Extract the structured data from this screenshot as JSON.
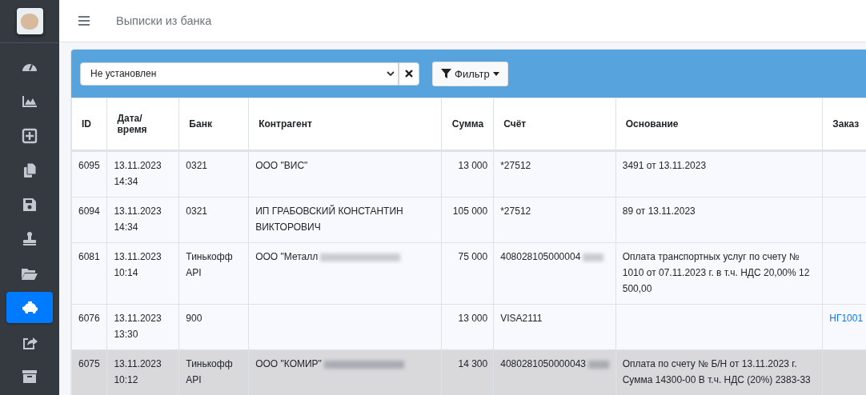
{
  "header": {
    "title": "Выписки из банка"
  },
  "sidebar": {
    "items": [
      {
        "selected": false
      },
      {
        "selected": false
      },
      {
        "selected": false
      },
      {
        "selected": false
      },
      {
        "selected": false
      },
      {
        "selected": false
      },
      {
        "selected": false
      },
      {
        "selected": true
      },
      {
        "selected": false
      },
      {
        "selected": false
      }
    ]
  },
  "filter": {
    "select_value": "Не установлен",
    "filter_button": "Фильтр"
  },
  "table": {
    "columns": [
      "ID",
      "Дата/ время",
      "Банк",
      "Контрагент",
      "Сумма",
      "Счёт",
      "Основание",
      "Заказ"
    ],
    "rows": [
      {
        "id": "6095",
        "date": "13.11.2023",
        "time": "14:34",
        "bank": "0321",
        "counterparty": "ООО \"ВИС\"",
        "counterparty_redacted": false,
        "amount": "13 000",
        "account": "*27512",
        "account_redacted": false,
        "basis": "3491 от 13.11.2023",
        "order": "",
        "highlighted": false
      },
      {
        "id": "6094",
        "date": "13.11.2023",
        "time": "14:34",
        "bank": "0321",
        "counterparty": "ИП ГРАБОВСКИЙ КОНСТАНТИН ВИКТОРОВИЧ",
        "counterparty_redacted": false,
        "amount": "105 000",
        "account": "*27512",
        "account_redacted": false,
        "basis": "89 от 13.11.2023",
        "order": "",
        "highlighted": false
      },
      {
        "id": "6081",
        "date": "13.11.2023",
        "time": "10:14",
        "bank": "Тинькофф API",
        "counterparty": "ООО \"Металл",
        "counterparty_redacted": true,
        "amount": "75 000",
        "account": "408028105000004",
        "account_redacted": true,
        "basis": "Оплата транспортных услуг по счету № 1010 от 07.11.2023 г. в т.ч. НДС 20,00% 12 500,00",
        "order": "",
        "highlighted": false
      },
      {
        "id": "6076",
        "date": "13.11.2023",
        "time": "13:30",
        "bank": "900",
        "counterparty": "",
        "counterparty_redacted": false,
        "amount": "13 000",
        "account": "VISA2111",
        "account_redacted": false,
        "basis": "",
        "order": "НГ1001",
        "highlighted": false
      },
      {
        "id": "6075",
        "date": "13.11.2023",
        "time": "10:12",
        "bank": "Тинькофф API",
        "counterparty": "ООО \"КОМИР\"",
        "counterparty_redacted": true,
        "amount": "14 300",
        "account": "4080281050000043",
        "account_redacted": true,
        "basis": "Оплата по счету № Б/Н от 13.11.2023 г. Сумма 14300-00 В т.ч. НДС (20%) 2383-33",
        "order": "",
        "highlighted": true
      }
    ]
  }
}
